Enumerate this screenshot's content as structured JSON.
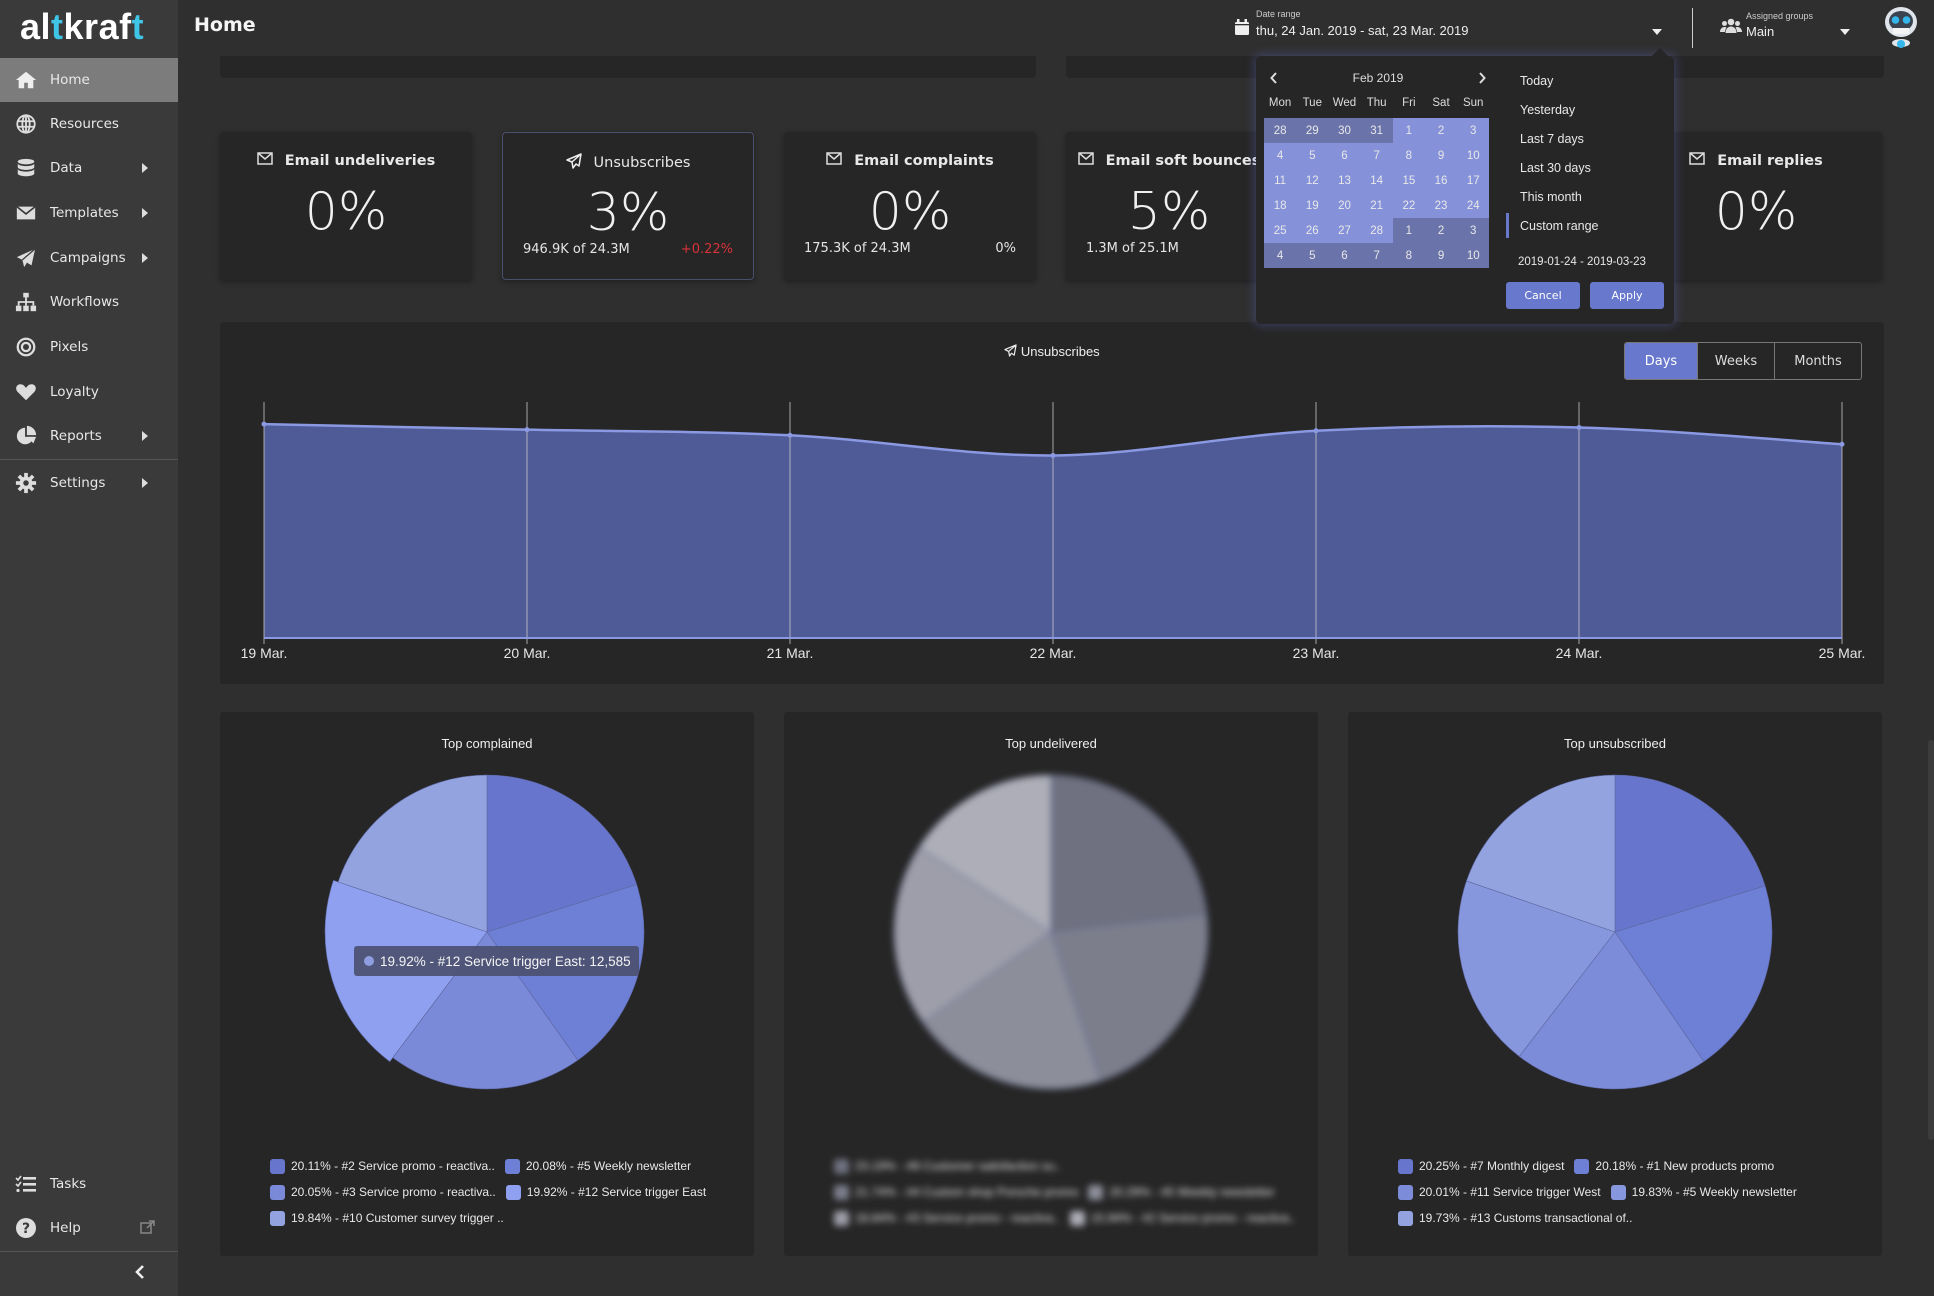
{
  "app": {
    "logo": "altkraft",
    "page_title": "Home"
  },
  "sidebar": {
    "items": [
      {
        "label": "Home",
        "icon": "home-icon",
        "active": true,
        "submenu": false
      },
      {
        "label": "Resources",
        "icon": "globe-icon",
        "submenu": false
      },
      {
        "label": "Data",
        "icon": "database-icon",
        "submenu": true
      },
      {
        "label": "Templates",
        "icon": "envelope-icon",
        "submenu": true
      },
      {
        "label": "Campaigns",
        "icon": "paper-plane-icon",
        "submenu": true
      },
      {
        "label": "Workflows",
        "icon": "sitemap-icon",
        "submenu": false
      },
      {
        "label": "Pixels",
        "icon": "target-icon",
        "submenu": false
      },
      {
        "label": "Loyalty",
        "icon": "heart-icon",
        "submenu": false
      },
      {
        "label": "Reports",
        "icon": "pie-chart-icon",
        "submenu": true
      },
      {
        "label": "Settings",
        "icon": "gear-icon",
        "submenu": true
      }
    ],
    "bottom": [
      {
        "label": "Tasks",
        "icon": "tasks-icon"
      },
      {
        "label": "Help",
        "icon": "help-icon",
        "external": true
      }
    ]
  },
  "header": {
    "date_range": {
      "label": "Date range",
      "value": "thu, 24 Jan. 2019 - sat, 23 Mar. 2019"
    },
    "groups": {
      "label": "Assigned groups",
      "value": "Main"
    }
  },
  "cards": [
    {
      "title": "Email undeliveries",
      "icon": "envelope-icon",
      "value": "0%",
      "sub": "",
      "delta": ""
    },
    {
      "title": "Unsubscribes",
      "icon": "paper-plane-icon",
      "value": "3%",
      "sub": "946.9K of 24.3M",
      "delta": "+0.22%",
      "delta_color": "#d9323a",
      "selected": true
    },
    {
      "title": "Email complaints",
      "icon": "envelope-icon",
      "value": "0%",
      "sub": "175.3K of 24.3M",
      "delta": "0%"
    },
    {
      "title": "Email soft bounces",
      "icon": "envelope-icon",
      "value": "5%",
      "sub": "1.3M of 25.1M",
      "delta": ""
    },
    {
      "title": "Email replies",
      "icon": "envelope-icon",
      "value": "0%",
      "sub": "",
      "delta": ""
    }
  ],
  "line_panel": {
    "period_tabs": [
      {
        "label": "Days",
        "active": true
      },
      {
        "label": "Weeks"
      },
      {
        "label": "Months"
      }
    ]
  },
  "date_picker": {
    "month": "Feb 2019",
    "weekdays": [
      "Mon",
      "Tue",
      "Wed",
      "Thu",
      "Fri",
      "Sat",
      "Sun"
    ],
    "weeks": [
      [
        [
          "28",
          0
        ],
        [
          "29",
          0
        ],
        [
          "30",
          0
        ],
        [
          "31",
          0
        ],
        [
          "1",
          1
        ],
        [
          "2",
          1
        ],
        [
          "3",
          1
        ]
      ],
      [
        [
          "4",
          1
        ],
        [
          "5",
          1
        ],
        [
          "6",
          1
        ],
        [
          "7",
          1
        ],
        [
          "8",
          1
        ],
        [
          "9",
          1
        ],
        [
          "10",
          1
        ]
      ],
      [
        [
          "11",
          1
        ],
        [
          "12",
          1
        ],
        [
          "13",
          1
        ],
        [
          "14",
          1
        ],
        [
          "15",
          1
        ],
        [
          "16",
          1
        ],
        [
          "17",
          1
        ]
      ],
      [
        [
          "18",
          1
        ],
        [
          "19",
          1
        ],
        [
          "20",
          1
        ],
        [
          "21",
          1
        ],
        [
          "22",
          1
        ],
        [
          "23",
          1
        ],
        [
          "24",
          1
        ]
      ],
      [
        [
          "25",
          1
        ],
        [
          "26",
          1
        ],
        [
          "27",
          1
        ],
        [
          "28",
          1
        ],
        [
          "1",
          0
        ],
        [
          "2",
          0
        ],
        [
          "3",
          0
        ]
      ],
      [
        [
          "4",
          0
        ],
        [
          "5",
          0
        ],
        [
          "6",
          0
        ],
        [
          "7",
          0
        ],
        [
          "8",
          0
        ],
        [
          "9",
          0
        ],
        [
          "10",
          0
        ]
      ]
    ],
    "ranges": [
      "Today",
      "Yesterday",
      "Last 7 days",
      "Last 30 days",
      "This month",
      "Custom range"
    ],
    "active_range": "Custom range",
    "range_text": "2019-01-24 - 2019-03-23",
    "cancel_label": "Cancel",
    "apply_label": "Apply"
  },
  "tooltip": {
    "text": "19.92% - #12 Service trigger East: 12,585"
  },
  "chart_data": [
    {
      "type": "area",
      "title": "Unsubscribes",
      "x": [
        "19 Mar.",
        "20 Mar.",
        "21 Mar.",
        "22 Mar.",
        "23 Mar.",
        "24 Mar.",
        "25 Mar."
      ],
      "series": [
        {
          "name": "Unsubscribes",
          "values": [
            0.955,
            0.93,
            0.905,
            0.815,
            0.925,
            0.94,
            0.865
          ]
        }
      ],
      "ylim": [
        0,
        1
      ],
      "yticks_visible": false,
      "grid": "vertical",
      "color": "#8a99e2",
      "fill": "#4f5b96"
    },
    {
      "type": "pie",
      "title": "Top complained",
      "categories": [
        "#2 Service promo - reactiva..",
        "#5 Weekly newsletter",
        "#3 Service promo - reactiva..",
        "#12 Service trigger East",
        "#10 Customer survey trigger .."
      ],
      "values": [
        20.11,
        20.08,
        20.05,
        19.92,
        19.84
      ],
      "colors": [
        "#6776cc",
        "#6e80d6",
        "#7a89d8",
        "#8fa0f0",
        "#93a3e0"
      ],
      "highlighted": 3,
      "legend": "bottom"
    },
    {
      "type": "pie",
      "title": "Top undelivered",
      "blurred": true,
      "categories": [
        "#8 Customer satisfaction su..",
        "#4 Custom shop Porsche promo",
        "#5 Weekly newsletter",
        "#3 Service promo - reactiva..",
        "#2 Service promo - reactiva.."
      ],
      "values": [
        23.19,
        21.74,
        20.29,
        18.84,
        15.94
      ],
      "colors": [
        "#6f7180",
        "#7c7e8c",
        "#8c8e9a",
        "#9d9ea9",
        "#adaeb7"
      ],
      "legend": "bottom"
    },
    {
      "type": "pie",
      "title": "Top unsubscribed",
      "categories": [
        "#7 Monthly digest",
        "#1 New products promo",
        "#11 Service trigger West",
        "#5 Weekly newsletter",
        "#13 Customs transactional of.."
      ],
      "values": [
        20.25,
        20.18,
        20.01,
        19.83,
        19.73
      ],
      "colors": [
        "#6776cc",
        "#6e80d6",
        "#7c8cd9",
        "#8797dd",
        "#93a3e0"
      ],
      "legend": "bottom"
    }
  ]
}
